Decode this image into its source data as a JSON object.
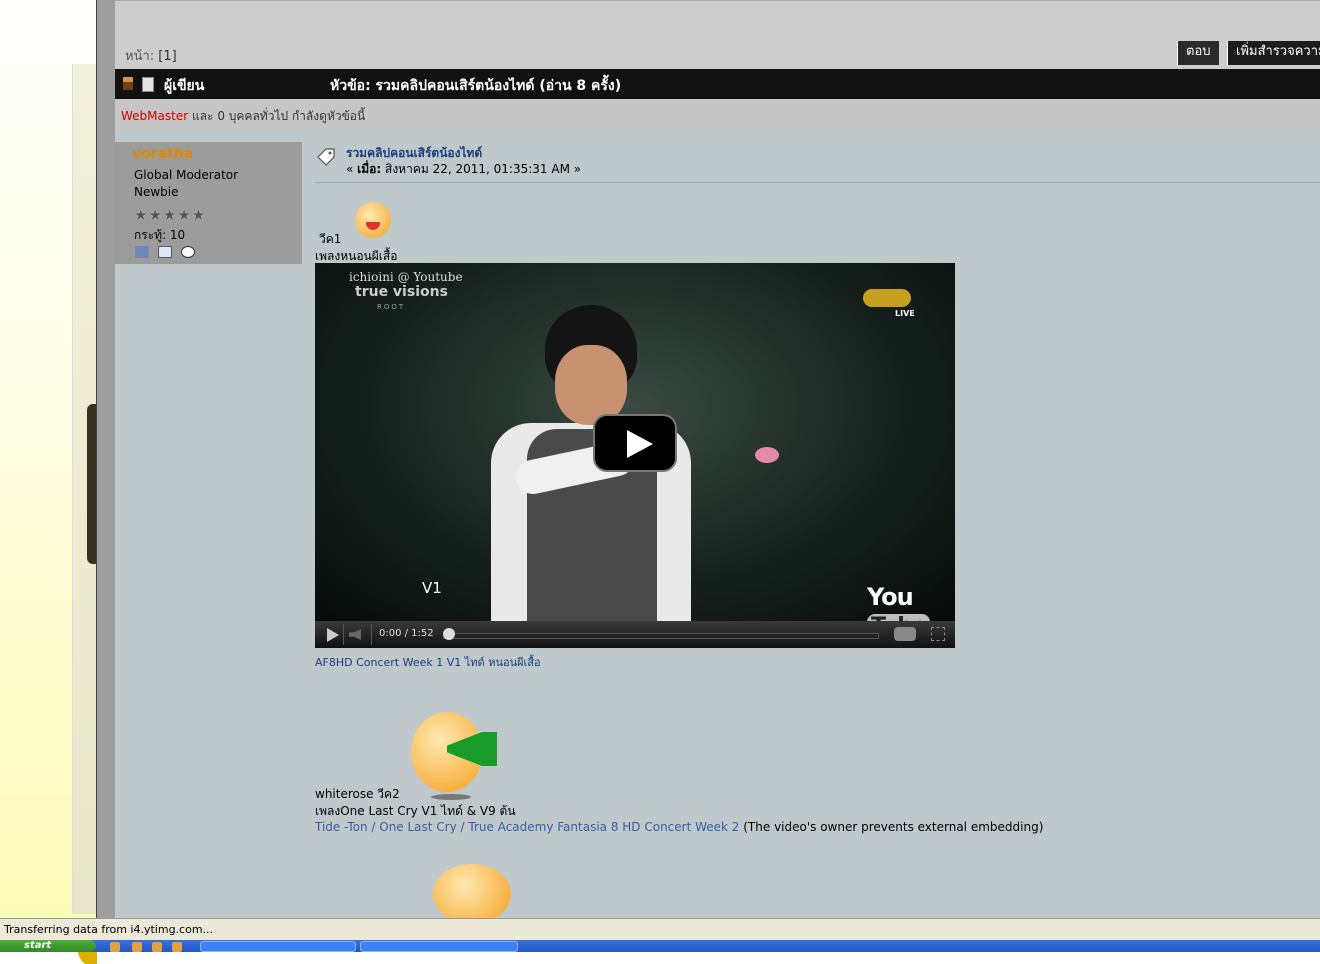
{
  "pagination": {
    "label": "หน้า:",
    "current": "[1]"
  },
  "buttons": {
    "reply": "ตอบ",
    "add_poll": "เพิ่มสำรวจความ"
  },
  "catbar": {
    "author_label": "ผู้เขียน",
    "topic_label": "หัวข้อ: รวมคลิปคอนเสิร์ตน้องไทด์  (อ่าน 8 ครั้ง)"
  },
  "viewers": {
    "user": "WebMaster",
    "rest": " และ 0 บุคคลทั่วไป กำลังดูหัวข้อนี้"
  },
  "poster": {
    "username": "voratha",
    "role": "Global Moderator",
    "rank": "Newbie",
    "stars": "★★★★★",
    "posts": "กระทู้: 10"
  },
  "post": {
    "title": "รวมคลิปคอนเสิร์ตน้องไทด์",
    "date_prefix": "« ",
    "date_label": "เมื่อ:",
    "date": " สิงหาคม 22, 2011, 01:35:31 AM »",
    "line1": "วีค1",
    "line2": "เพลงหนอนผีเสื้อ",
    "video_caption": "AF8HD Concert Week 1 V1 ไทด์ หนอนผีเสื้อ",
    "line3": "whiterose วีค2",
    "line4": "เพลงOne Last Cry  V1 ไทด์ & V9 ต้น",
    "link_text": "Tide -Ton / One Last Cry / True Academy Fantasia 8 HD Concert Week 2",
    "link_note": " (The video's owner prevents external embedding)"
  },
  "video": {
    "watermark1": "ichioini @ Youtube",
    "watermark2": "true visions",
    "watermark3": "ROOT",
    "live": "LIVE",
    "label": "V1",
    "brand_you": "You",
    "brand_tube": "Tube",
    "time": "0:00 / 1:52",
    "progress": 0
  },
  "status": {
    "text": "Transferring data from i4.ytimg.com..."
  },
  "taskbar": {
    "start": "start"
  }
}
